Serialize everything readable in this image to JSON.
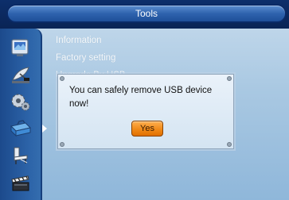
{
  "header": {
    "title": "Tools"
  },
  "sidebar": {
    "items": [
      {
        "icon": "information-icon"
      },
      {
        "icon": "satellite-dish-icon"
      },
      {
        "icon": "settings-gears-icon"
      },
      {
        "icon": "toolbox-icon",
        "selected": true
      },
      {
        "icon": "chair-icon"
      },
      {
        "icon": "clapperboard-icon"
      }
    ]
  },
  "menu": {
    "items": [
      {
        "label": "Information"
      },
      {
        "label": "Factory setting"
      },
      {
        "label": "Upgrade By USB"
      },
      {
        "label": ""
      }
    ]
  },
  "dialog": {
    "message": "You can safely remove USB device now!",
    "button_label": "Yes"
  },
  "colors": {
    "header": "#2f63ae",
    "sidebar": "#2c63a8",
    "background": "#a9c8e2",
    "button": "#f08a1a"
  }
}
